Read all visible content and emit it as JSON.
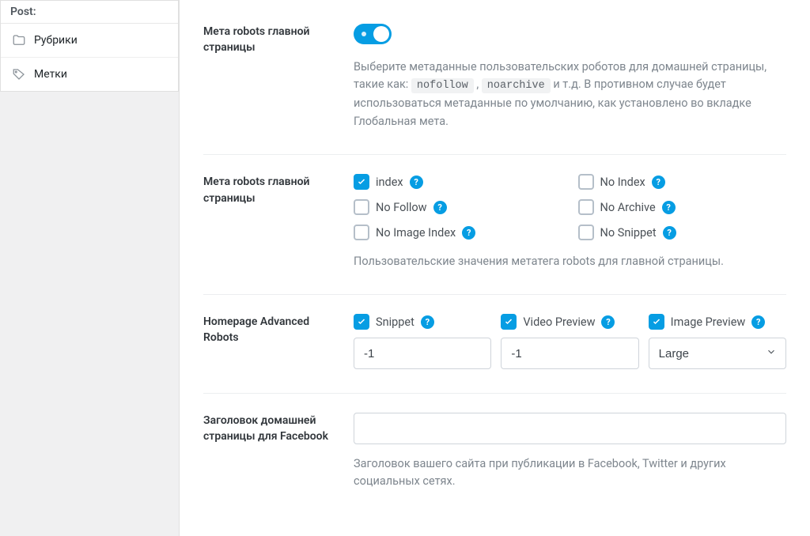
{
  "sidebar": {
    "header": "Post:",
    "items": [
      {
        "label": "Рубрики",
        "icon": "folder-icon"
      },
      {
        "label": "Метки",
        "icon": "tag-icon"
      }
    ]
  },
  "sections": {
    "robots_toggle": {
      "label": "Мета robots главной страницы",
      "on": true,
      "desc_pre": "Выберите метаданные пользовательских роботов для домашней страницы, такие как: ",
      "tag1": "nofollow",
      "sep": " , ",
      "tag2": "noarchive",
      "desc_post": " и т.д. В противном случае будет использоваться метаданные по умолчанию, как установлено во вкладке Глобальная мета."
    },
    "robots_checks": {
      "label": "Мета robots главной страницы",
      "items": [
        {
          "label": "index",
          "checked": true,
          "help": true
        },
        {
          "label": "No Index",
          "checked": false,
          "help": true
        },
        {
          "label": "No Follow",
          "checked": false,
          "help": true
        },
        {
          "label": "No Archive",
          "checked": false,
          "help": true
        },
        {
          "label": "No Image Index",
          "checked": false,
          "help": true
        },
        {
          "label": "No Snippet",
          "checked": false,
          "help": true
        }
      ],
      "hint": "Пользовательские значения метатега robots для главной страницы."
    },
    "adv_robots": {
      "label": "Homepage Advanced Robots",
      "cols": [
        {
          "label": "Snippet",
          "checked": true,
          "value": "-1",
          "kind": "text"
        },
        {
          "label": "Video Preview",
          "checked": true,
          "value": "-1",
          "kind": "text"
        },
        {
          "label": "Image Preview",
          "checked": true,
          "value": "Large",
          "kind": "select"
        }
      ]
    },
    "fb": {
      "label": "Заголовок домашней страницы для Facebook",
      "value": "",
      "hint": "Заголовок вашего сайта при публикации в Facebook, Twitter и других социальных сетях."
    }
  },
  "help_glyph": "?"
}
